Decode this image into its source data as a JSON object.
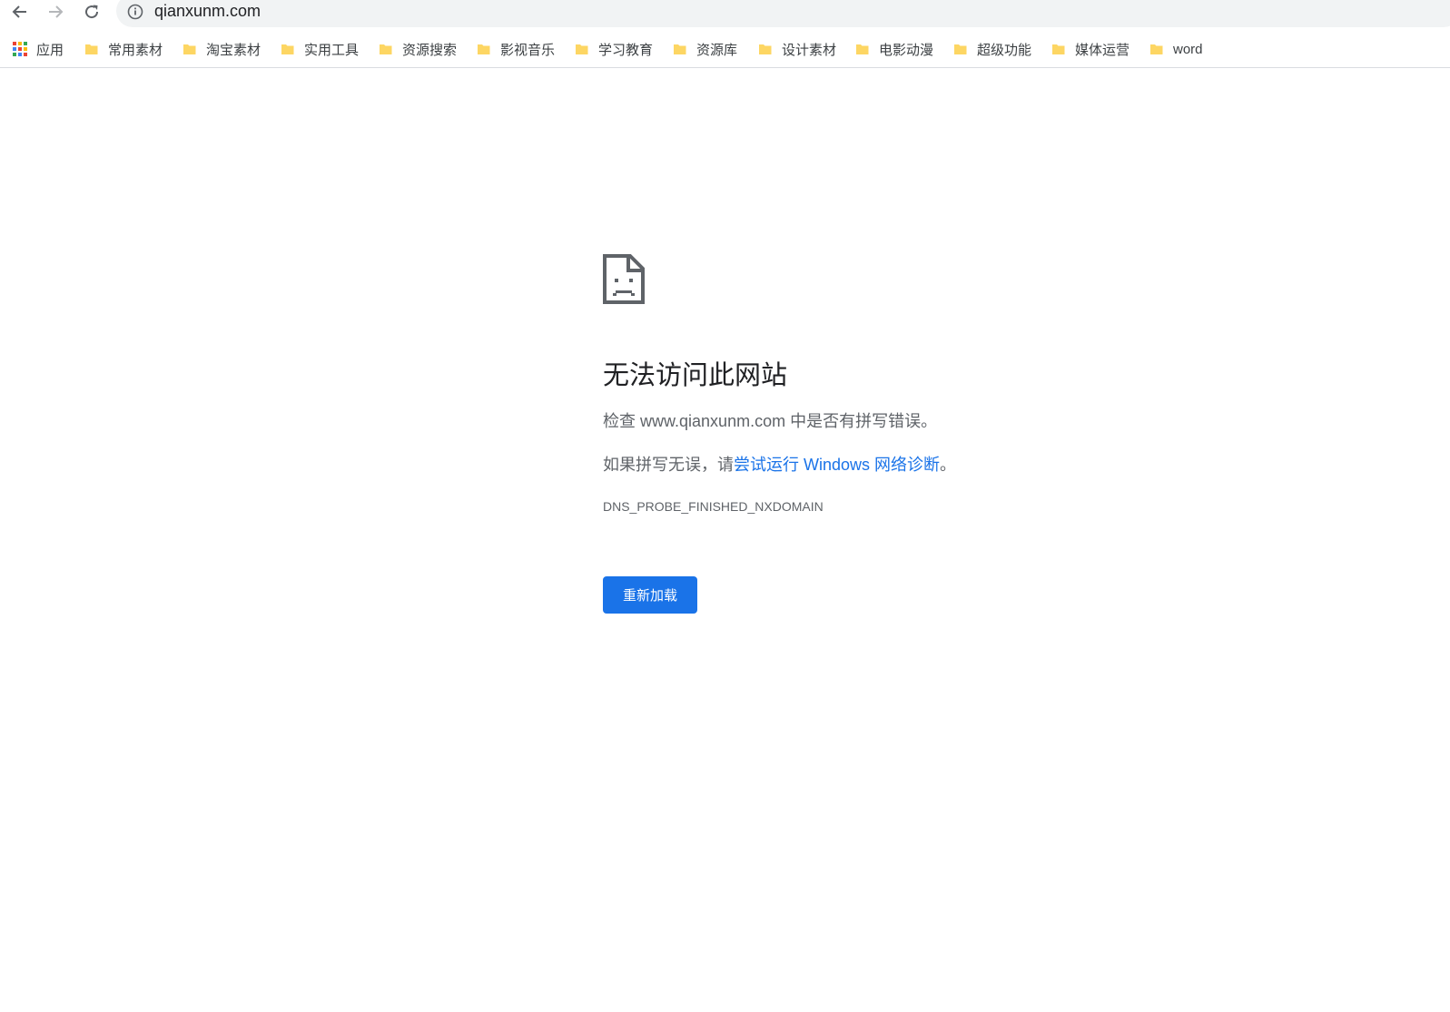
{
  "browser": {
    "url": "qianxunm.com",
    "nav": {
      "back_icon": "arrow-left-icon",
      "forward_icon": "arrow-right-icon",
      "reload_icon": "reload-icon",
      "info_icon": "info-icon"
    }
  },
  "bookmarks": {
    "apps_label": "应用",
    "items": [
      {
        "label": "常用素材"
      },
      {
        "label": "淘宝素材"
      },
      {
        "label": "实用工具"
      },
      {
        "label": "资源搜索"
      },
      {
        "label": "影视音乐"
      },
      {
        "label": "学习教育"
      },
      {
        "label": "资源库"
      },
      {
        "label": "设计素材"
      },
      {
        "label": "电影动漫"
      },
      {
        "label": "超级功能"
      },
      {
        "label": "媒体运营"
      },
      {
        "label": "word"
      }
    ]
  },
  "error_page": {
    "title": "无法访问此网站",
    "check_prefix": "检查 ",
    "check_domain": "www.qianxunm.com",
    "check_suffix": " 中是否有拼写错误。",
    "suggest_prefix": "如果拼写无误，请",
    "suggest_link": "尝试运行 Windows 网络诊断",
    "suggest_suffix": "。",
    "error_code": "DNS_PROBE_FINISHED_NXDOMAIN",
    "reload_label": "重新加载"
  },
  "colors": {
    "accent": "#1a73e8",
    "folder": "#fdd663",
    "text_primary": "#202124",
    "text_secondary": "#5f6368"
  }
}
